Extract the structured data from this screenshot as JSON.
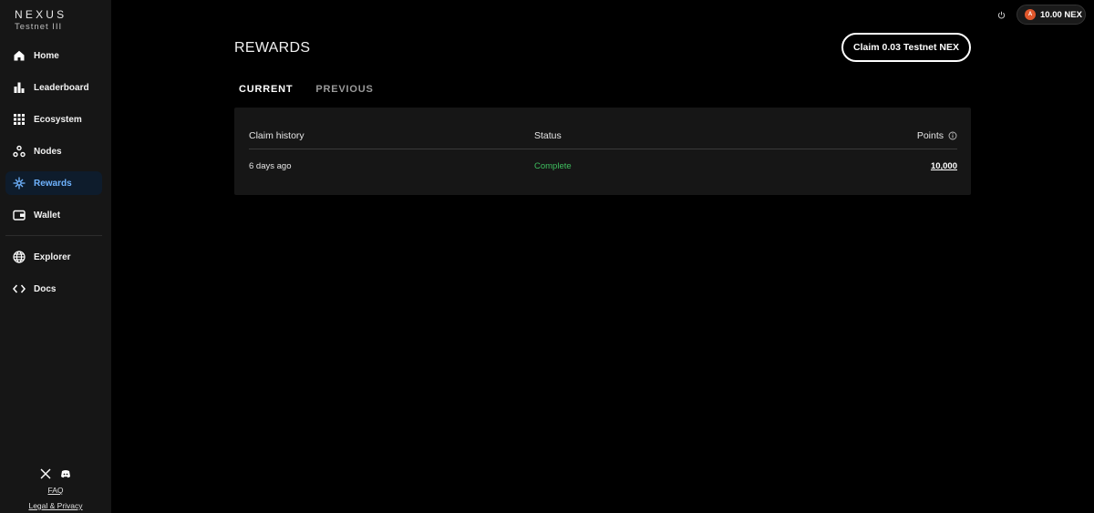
{
  "brand": {
    "name": "NEXUS",
    "subtitle": "Testnet III"
  },
  "sidebar": {
    "items": [
      {
        "label": "Home",
        "icon": "home-icon"
      },
      {
        "label": "Leaderboard",
        "icon": "bar-chart-icon"
      },
      {
        "label": "Ecosystem",
        "icon": "grid-icon"
      },
      {
        "label": "Nodes",
        "icon": "nodes-icon"
      },
      {
        "label": "Rewards",
        "icon": "sparkle-icon",
        "active": true
      },
      {
        "label": "Wallet",
        "icon": "wallet-icon"
      },
      {
        "label": "Explorer",
        "icon": "globe-icon"
      },
      {
        "label": "Docs",
        "icon": "code-icon"
      }
    ],
    "footer": {
      "faq": "FAQ",
      "legal": "Legal & Privacy"
    }
  },
  "header": {
    "balance": "10.00 NEX",
    "avatar_letter": "A"
  },
  "main": {
    "title": "REWARDS",
    "claim_button": "Claim 0.03 Testnet NEX",
    "tabs": [
      {
        "label": "CURRENT",
        "active": true
      },
      {
        "label": "PREVIOUS",
        "active": false
      }
    ],
    "table": {
      "columns": [
        "Claim history",
        "Status",
        "Points"
      ],
      "rows": [
        {
          "time": "6 days ago",
          "status": "Complete",
          "points": "10,000"
        }
      ]
    }
  },
  "colors": {
    "accent": "#6fb3ff",
    "active_bg": "#0e1c2c",
    "status_complete": "#3fbf5f",
    "panel": "#161616"
  }
}
